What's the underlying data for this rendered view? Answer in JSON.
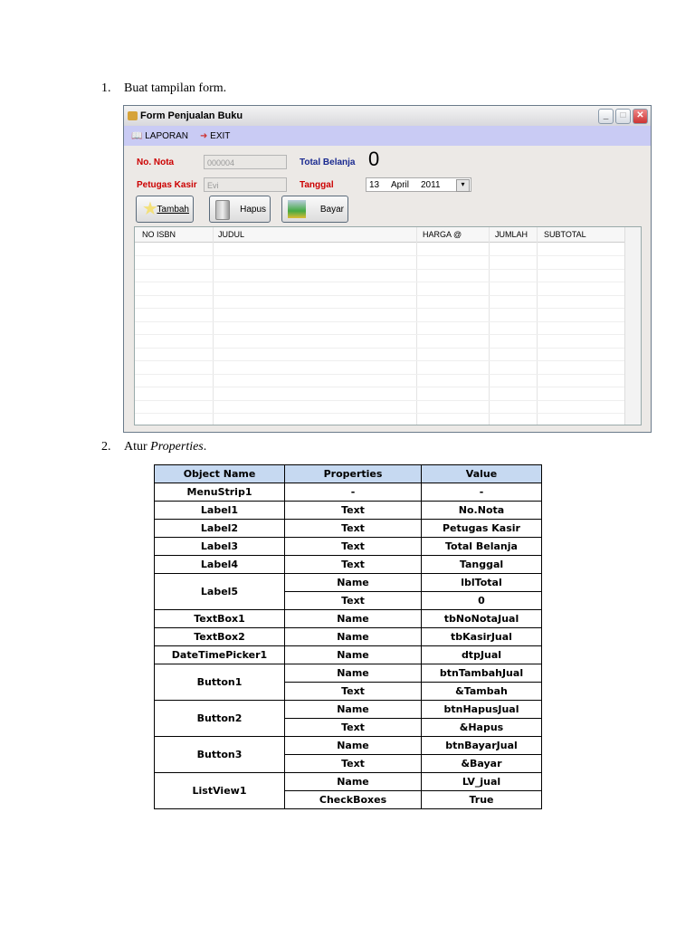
{
  "step1": {
    "num": "1.",
    "text": "Buat tampilan form."
  },
  "step2": {
    "num": "2.",
    "text": "Atur ",
    "em": "Properties",
    "end": "."
  },
  "form": {
    "title": "Form Penjualan Buku",
    "menu": [
      "LAPORAN",
      "EXIT"
    ],
    "no_nota_label": "No. Nota",
    "no_nota_value": "000004",
    "total_label": "Total Belanja",
    "total_value": "0",
    "kasir_label": "Petugas Kasir",
    "kasir_value": "Evi",
    "tanggal_label": "Tanggal",
    "date": {
      "day": "13",
      "month": "April",
      "year": "2011"
    },
    "buttons": [
      "Tambah",
      "Hapus",
      "Bayar"
    ],
    "columns": [
      "NO ISBN",
      "JUDUL",
      "HARGA @",
      "JUMLAH",
      "SUBTOTAL"
    ]
  },
  "table": {
    "headers": [
      "Object Name",
      "Properties",
      "Value"
    ],
    "rows": [
      {
        "obj": "MenuStrip1",
        "props": [
          [
            "-",
            "-"
          ]
        ]
      },
      {
        "obj": "Label1",
        "props": [
          [
            "Text",
            "No.Nota"
          ]
        ]
      },
      {
        "obj": "Label2",
        "props": [
          [
            "Text",
            "Petugas Kasir"
          ]
        ]
      },
      {
        "obj": "Label3",
        "props": [
          [
            "Text",
            "Total Belanja"
          ]
        ]
      },
      {
        "obj": "Label4",
        "props": [
          [
            "Text",
            "Tanggal"
          ]
        ]
      },
      {
        "obj": "Label5",
        "props": [
          [
            "Name",
            "lblTotal"
          ],
          [
            "Text",
            "0"
          ]
        ]
      },
      {
        "obj": "TextBox1",
        "props": [
          [
            "Name",
            "tbNoNotaJual"
          ]
        ]
      },
      {
        "obj": "TextBox2",
        "props": [
          [
            "Name",
            "tbKasirJual"
          ]
        ]
      },
      {
        "obj": "DateTimePicker1",
        "props": [
          [
            "Name",
            "dtpJual"
          ]
        ]
      },
      {
        "obj": "Button1",
        "props": [
          [
            "Name",
            "btnTambahJual"
          ],
          [
            "Text",
            "&Tambah"
          ]
        ]
      },
      {
        "obj": "Button2",
        "props": [
          [
            "Name",
            "btnHapusJual"
          ],
          [
            "Text",
            "&Hapus"
          ]
        ]
      },
      {
        "obj": "Button3",
        "props": [
          [
            "Name",
            "btnBayarJual"
          ],
          [
            "Text",
            "&Bayar"
          ]
        ]
      },
      {
        "obj": "ListView1",
        "props": [
          [
            "Name",
            "LV_jual"
          ],
          [
            "CheckBoxes",
            "True"
          ]
        ]
      }
    ]
  }
}
